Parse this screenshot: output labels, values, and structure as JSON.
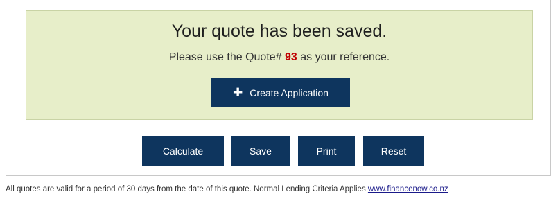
{
  "quote_panel": {
    "title": "Your quote has been saved.",
    "ref_prefix": "Please use the Quote# ",
    "quote_number": "93",
    "ref_suffix": " as your reference.",
    "create_application_label": "Create Application",
    "create_application_icon": "plus-icon"
  },
  "actions": {
    "calculate_label": "Calculate",
    "save_label": "Save",
    "print_label": "Print",
    "reset_label": "Reset"
  },
  "footer": {
    "disclaimer": "All quotes are valid for a period of 30 days from the date of this quote. Normal Lending Criteria Applies ",
    "link_text": "www.financenow.co.nz"
  },
  "colors": {
    "button_bg": "#0e355e",
    "panel_bg": "#e7eec9",
    "quote_number": "#c00000"
  }
}
